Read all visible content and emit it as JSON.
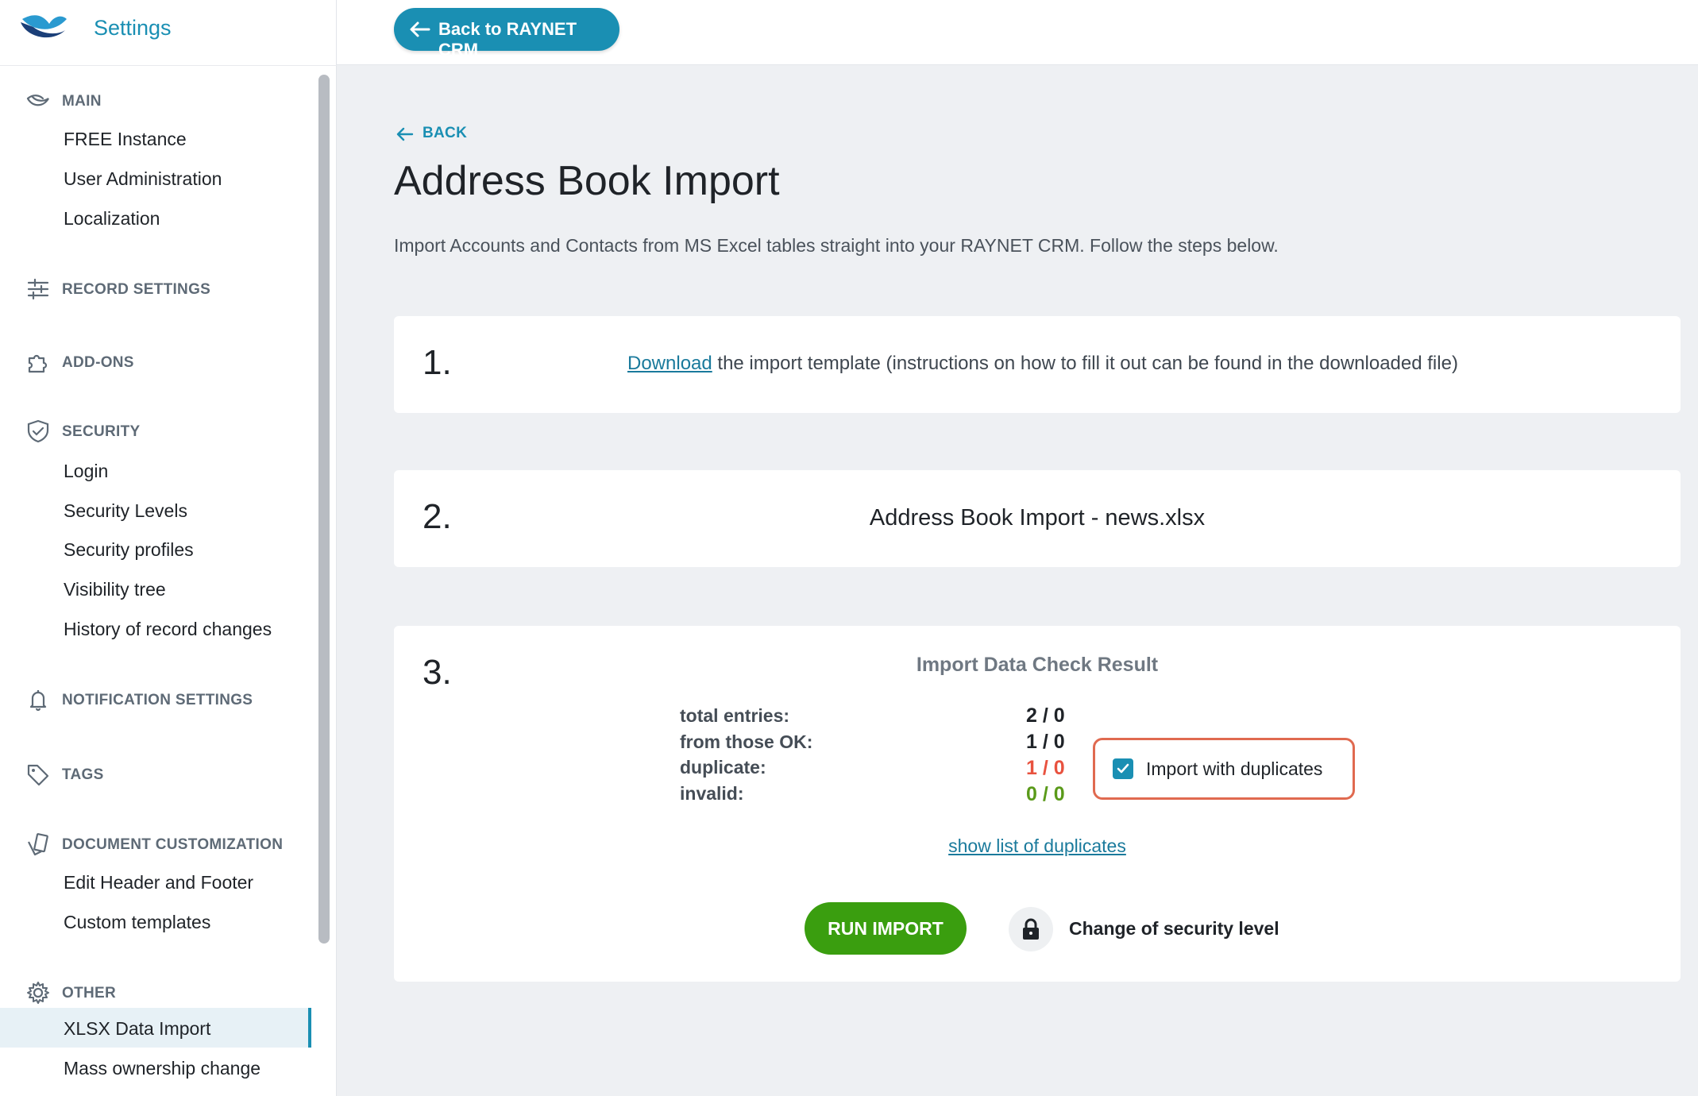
{
  "brand": {
    "title": "Settings"
  },
  "sidebar": {
    "sections": [
      {
        "label": "MAIN",
        "icon": "bird-icon",
        "items": [
          "FREE Instance",
          "User Administration",
          "Localization"
        ]
      },
      {
        "label": "RECORD SETTINGS",
        "icon": "sliders-icon",
        "items": []
      },
      {
        "label": "ADD-ONS",
        "icon": "puzzle-icon",
        "items": []
      },
      {
        "label": "SECURITY",
        "icon": "shield-icon",
        "items": [
          "Login",
          "Security Levels",
          "Security profiles",
          "Visibility tree",
          "History of record changes"
        ]
      },
      {
        "label": "NOTIFICATION SETTINGS",
        "icon": "bell-icon",
        "items": []
      },
      {
        "label": "TAGS",
        "icon": "tag-icon",
        "items": []
      },
      {
        "label": "DOCUMENT CUSTOMIZATION",
        "icon": "documents-icon",
        "items": [
          "Edit Header and Footer",
          "Custom templates"
        ]
      },
      {
        "label": "OTHER",
        "icon": "gear-icon",
        "items": [
          "XLSX Data Import",
          "Mass ownership change"
        ]
      }
    ],
    "active_item": "XLSX Data Import"
  },
  "topbar": {
    "back_label": "Back to RAYNET CRM"
  },
  "page": {
    "back_link": "BACK",
    "title": "Address Book Import",
    "description": "Import Accounts and Contacts from MS Excel tables straight into your RAYNET CRM. Follow the steps below."
  },
  "steps": {
    "one": {
      "num": "1.",
      "link": "Download",
      "text": " the import template (instructions on how to fill it out can be found in the downloaded file)"
    },
    "two": {
      "num": "2.",
      "file": "Address Book Import - news.xlsx"
    },
    "three": {
      "num": "3.",
      "title": "Import Data Check Result",
      "stats": [
        {
          "label": "total entries:",
          "value": "2 / 0",
          "tone": "default"
        },
        {
          "label": "from those OK:",
          "value": "1 / 0",
          "tone": "default"
        },
        {
          "label": "duplicate:",
          "value": "1 / 0",
          "tone": "red"
        },
        {
          "label": "invalid:",
          "value": "0 / 0",
          "tone": "green"
        }
      ],
      "checkbox_label": "Import with duplicates",
      "checkbox_checked": true,
      "show_duplicates": "show list of duplicates",
      "run_button": "RUN IMPORT",
      "security_label": "Change of security level"
    }
  },
  "colors": {
    "accent": "#1a8fb3",
    "run": "#3a9e0f",
    "red": "#e8523f",
    "green": "#5a9a1a",
    "highlight": "#e06a50"
  }
}
